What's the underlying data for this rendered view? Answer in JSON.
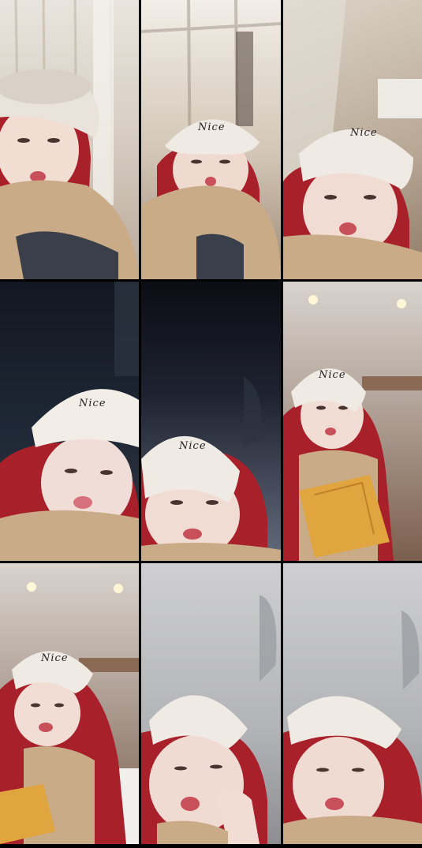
{
  "grid": {
    "columns": 3,
    "rows": 3
  },
  "cap_print": "Nice",
  "colors": {
    "separator": "#000000",
    "hair": "#a8202a",
    "cap": "#f1ede6",
    "scarf": "#c9ab88",
    "pastry": "#e0a53e"
  },
  "tiles": [
    {
      "scene": "indoor-curtain"
    },
    {
      "scene": "indoor-window"
    },
    {
      "scene": "indoor-corner"
    },
    {
      "scene": "dark-interior"
    },
    {
      "scene": "dark-interior"
    },
    {
      "scene": "cafe-with-pastry"
    },
    {
      "scene": "cafe-with-pastry"
    },
    {
      "scene": "car-interior"
    },
    {
      "scene": "car-interior"
    }
  ]
}
